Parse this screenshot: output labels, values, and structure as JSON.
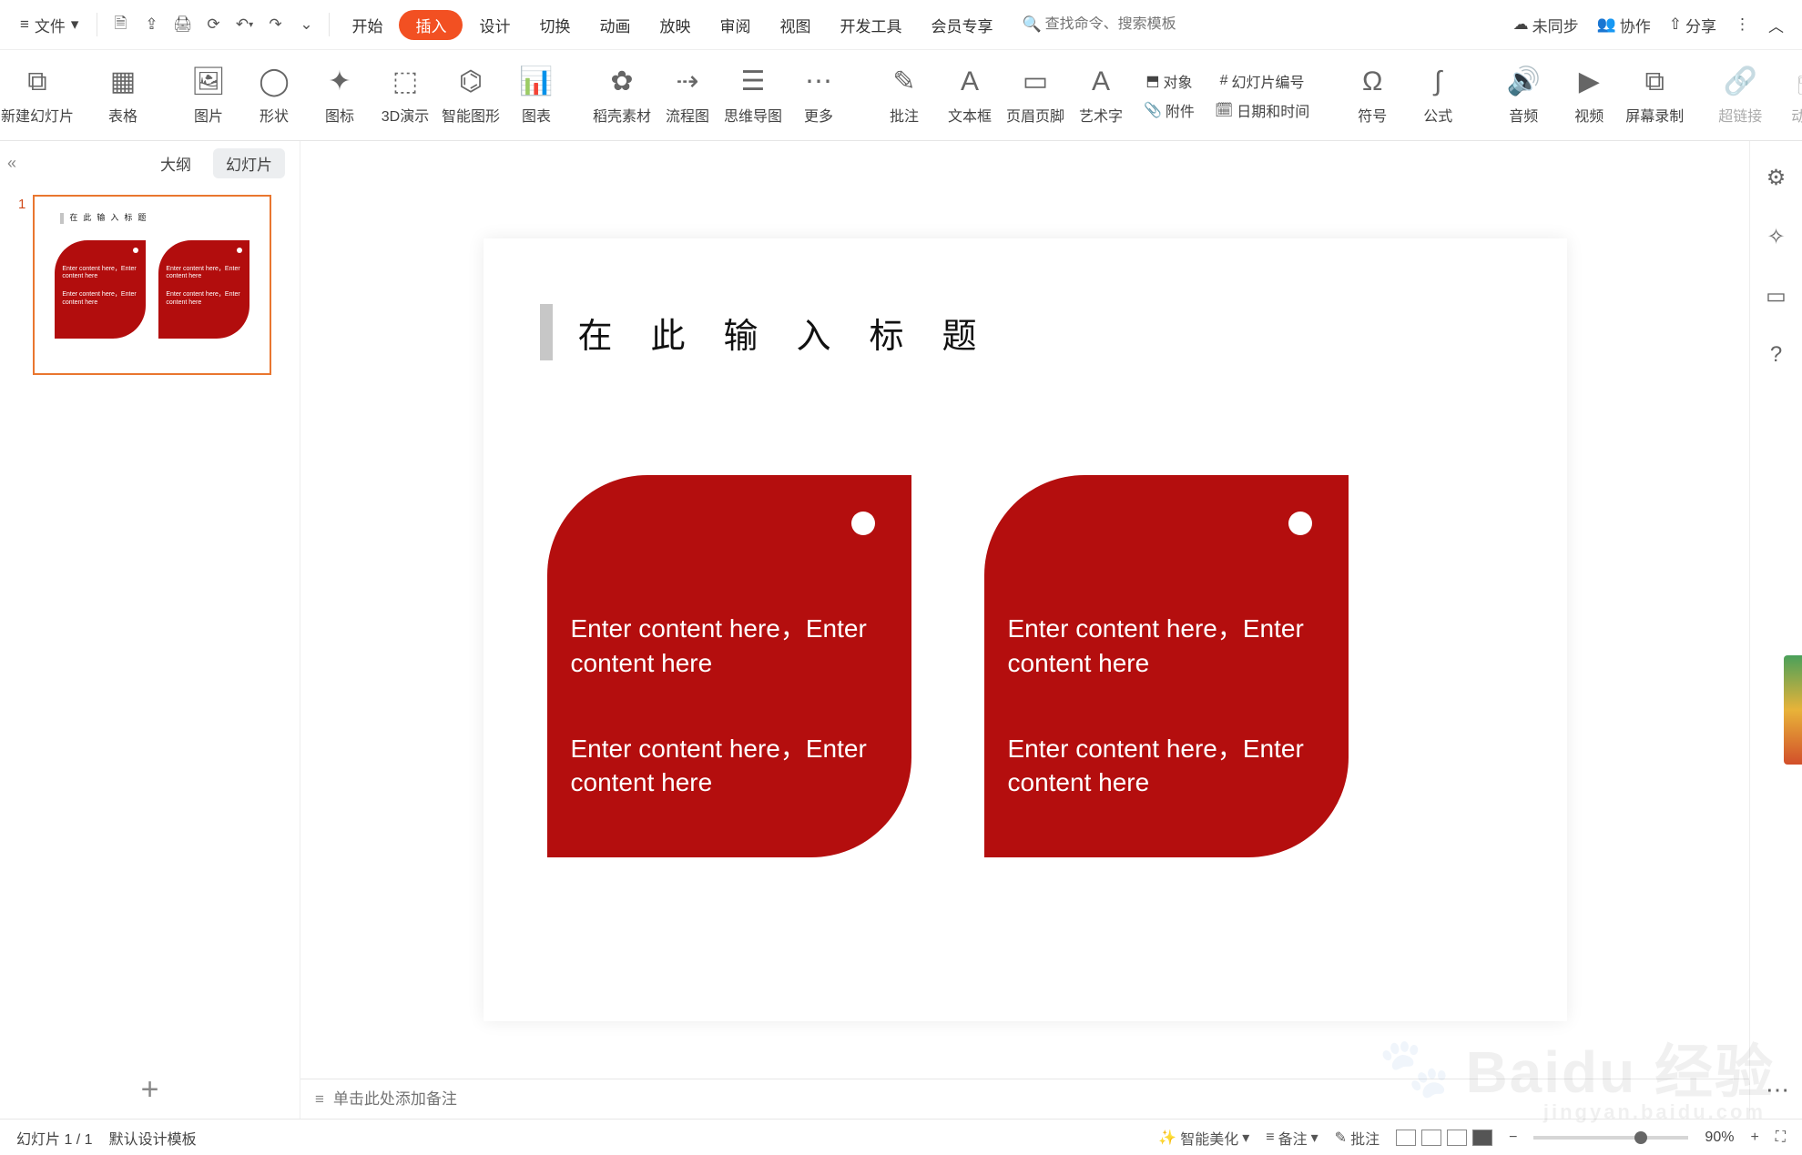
{
  "topbar": {
    "file_label": "文件",
    "search_placeholder": "查找命令、搜索模板",
    "tabs": [
      {
        "label": "开始"
      },
      {
        "label": "插入"
      },
      {
        "label": "设计"
      },
      {
        "label": "切换"
      },
      {
        "label": "动画"
      },
      {
        "label": "放映"
      },
      {
        "label": "审阅"
      },
      {
        "label": "视图"
      },
      {
        "label": "开发工具"
      },
      {
        "label": "会员专享"
      }
    ],
    "active_tab": "插入",
    "right": {
      "sync": "未同步",
      "coop": "协作",
      "share": "分享"
    }
  },
  "ribbon": {
    "items": [
      {
        "label": "新建幻灯片",
        "drop": true,
        "icon": "⧉"
      },
      {
        "label": "表格",
        "drop": true,
        "icon": "▦"
      },
      {
        "label": "图片",
        "drop": true,
        "icon": "🖼"
      },
      {
        "label": "形状",
        "drop": true,
        "icon": "◯"
      },
      {
        "label": "图标",
        "drop": true,
        "icon": "✦"
      },
      {
        "label": "3D演示",
        "icon": "⬚"
      },
      {
        "label": "智能图形",
        "icon": "⌬"
      },
      {
        "label": "图表",
        "drop": true,
        "icon": "📊"
      },
      {
        "label": "稻壳素材",
        "icon": "✿"
      },
      {
        "label": "流程图",
        "drop": true,
        "icon": "⇢"
      },
      {
        "label": "思维导图",
        "drop": true,
        "icon": "☰"
      },
      {
        "label": "更多",
        "drop": true,
        "icon": "⋯"
      },
      {
        "label": "批注",
        "icon": "✎"
      },
      {
        "label": "文本框",
        "drop": true,
        "icon": "A"
      },
      {
        "label": "页眉页脚",
        "icon": "▭"
      },
      {
        "label": "艺术字",
        "drop": true,
        "icon": "A"
      }
    ],
    "side_items": {
      "object": "对象",
      "slide_num": "幻灯片编号",
      "attach": "附件",
      "datetime": "日期和时间"
    },
    "tail": [
      {
        "label": "符号",
        "drop": true,
        "icon": "Ω"
      },
      {
        "label": "公式",
        "drop": true,
        "icon": "∫"
      },
      {
        "label": "音频",
        "drop": true,
        "icon": "🔊"
      },
      {
        "label": "视频",
        "drop": true,
        "icon": "▶"
      },
      {
        "label": "屏幕录制",
        "icon": "⧉"
      },
      {
        "label": "超链接",
        "drop": true,
        "icon": "🔗"
      },
      {
        "label": "动作",
        "icon": "🖱"
      }
    ]
  },
  "panel": {
    "tab_outline": "大纲",
    "tab_slides": "幻灯片",
    "slide_number": "1",
    "mini_title": "在此输入标题",
    "mini_text1": "Enter content here，Enter content here",
    "mini_text2": "Enter content here，Enter content here"
  },
  "slide": {
    "title": "在此输入标题",
    "card1_p1": "Enter content here，Enter content here",
    "card1_p2": "Enter content here，Enter content here",
    "card2_p1": "Enter content here，Enter content here",
    "card2_p2": "Enter content here，Enter content here"
  },
  "notes": {
    "placeholder": "单击此处添加备注"
  },
  "status": {
    "counter": "幻灯片 1 / 1",
    "template": "默认设计模板",
    "beautify": "智能美化",
    "notes": "备注",
    "comments": "批注",
    "zoom": "90%"
  },
  "watermark": {
    "main": "Baidu 经验",
    "sub": "jingyan.baidu.com"
  }
}
